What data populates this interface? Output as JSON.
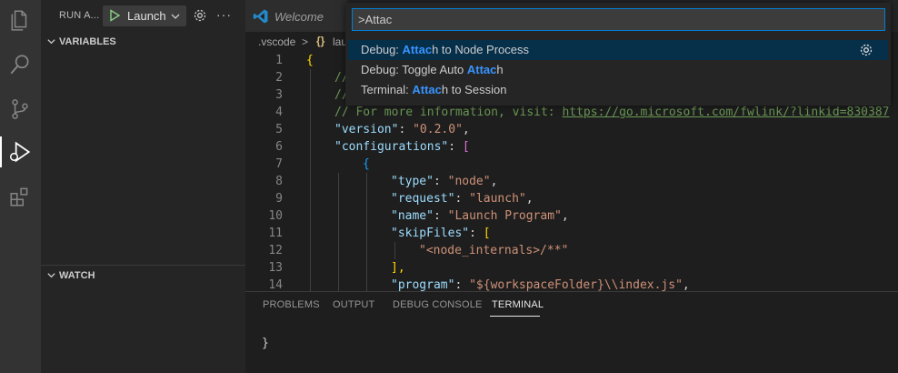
{
  "sidebar": {
    "title": "RUN A...",
    "config_label": "Launch",
    "more_label": "···",
    "sections": {
      "variables": "VARIABLES",
      "watch": "WATCH"
    }
  },
  "activity_icons": [
    "explorer-icon",
    "search-icon",
    "source-control-icon",
    "run-debug-icon",
    "extensions-icon"
  ],
  "tabs": [
    {
      "label": "Welcome"
    }
  ],
  "breadcrumb": {
    "folder": ".vscode",
    "separator": ">",
    "braces": "{}",
    "file": "lau"
  },
  "code": {
    "line_numbers": [
      "1",
      "2",
      "3",
      "4",
      "5",
      "6",
      "7",
      "8",
      "9",
      "10",
      "11",
      "12",
      "13",
      "14"
    ],
    "line1": "{",
    "line2": "//",
    "line3": "//",
    "line4_comment": "// For more information, visit: ",
    "line4_link": "https://go.microsoft.com/fwlink/?linkid=830387",
    "line5_key": "\"version\"",
    "line5_val": "\"0.2.0\"",
    "line6_key": "\"configurations\"",
    "line6_bracket": "[",
    "line7": "{",
    "line8_key": "\"type\"",
    "line8_val": "\"node\"",
    "line9_key": "\"request\"",
    "line9_val": "\"launch\"",
    "line10_key": "\"name\"",
    "line10_val": "\"Launch Program\"",
    "line11_key": "\"skipFiles\"",
    "line11_bracket": "[",
    "line12_val": "\"<node_internals>/**\"",
    "line13": "],",
    "line14_key": "\"program\"",
    "line14_val": "\"${workspaceFolder}\\\\index.js\""
  },
  "panel": {
    "tabs": [
      "PROBLEMS",
      "OUTPUT",
      "DEBUG CONSOLE",
      "TERMINAL"
    ],
    "active_tab": "TERMINAL",
    "terminal_text": "}"
  },
  "palette": {
    "input_value": ">Attac",
    "items": [
      {
        "prefix": "Debug: ",
        "highlight": "Attac",
        "suffix": "h to Node Process",
        "selected": true
      },
      {
        "prefix": "Debug: Toggle Auto ",
        "highlight": "Attac",
        "suffix": "h",
        "selected": false
      },
      {
        "prefix": "Terminal: ",
        "highlight": "Attac",
        "suffix": "h to Session",
        "selected": false
      }
    ]
  },
  "colors": {
    "accent": "#007fd4",
    "highlight": "#3794ff",
    "selection": "#062f4a",
    "play": "#89d185"
  }
}
